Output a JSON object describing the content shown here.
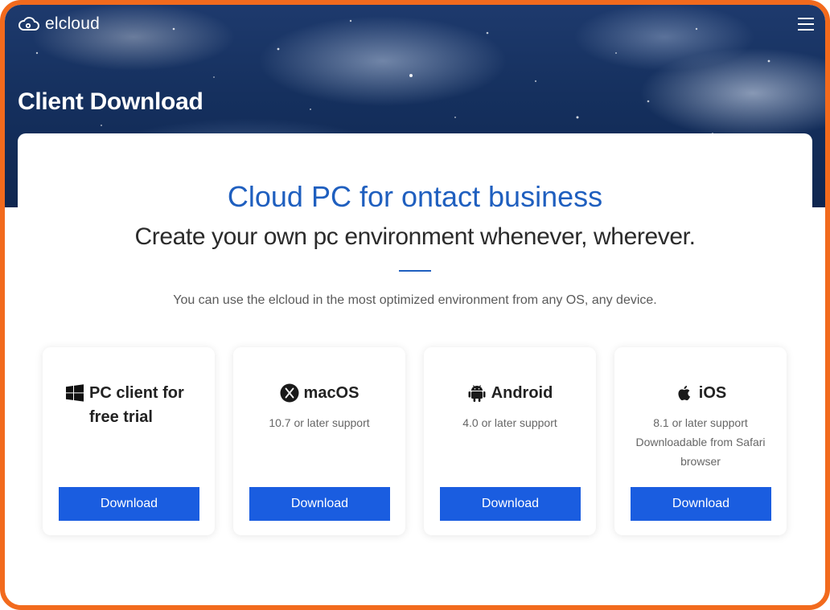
{
  "header": {
    "logo_text": "elcloud",
    "logo_icon": "cloud-icon",
    "menu_icon": "hamburger-menu-icon",
    "page_title": "Client Download"
  },
  "main": {
    "headline": "Cloud PC for ontact business",
    "subheadline": "Create your own pc environment whenever, wherever.",
    "description": "You can use the elcloud in the most optimized environment from any OS, any device."
  },
  "clients": [
    {
      "icon": "windows-icon",
      "title": "PC client for free trial",
      "notes": [],
      "button_label": "Download"
    },
    {
      "icon": "macos-x-icon",
      "title": "macOS",
      "notes": [
        "10.7 or later support"
      ],
      "button_label": "Download"
    },
    {
      "icon": "android-icon",
      "title": "Android",
      "notes": [
        "4.0 or later support"
      ],
      "button_label": "Download"
    },
    {
      "icon": "apple-icon",
      "title": "iOS",
      "notes": [
        "8.1 or later support",
        "Downloadable from Safari browser"
      ],
      "button_label": "Download"
    }
  ],
  "colors": {
    "accent": "#1f5fbf",
    "button": "#1a5de0",
    "frame_border": "#f26a1d",
    "hero_bg": "#15305e"
  }
}
